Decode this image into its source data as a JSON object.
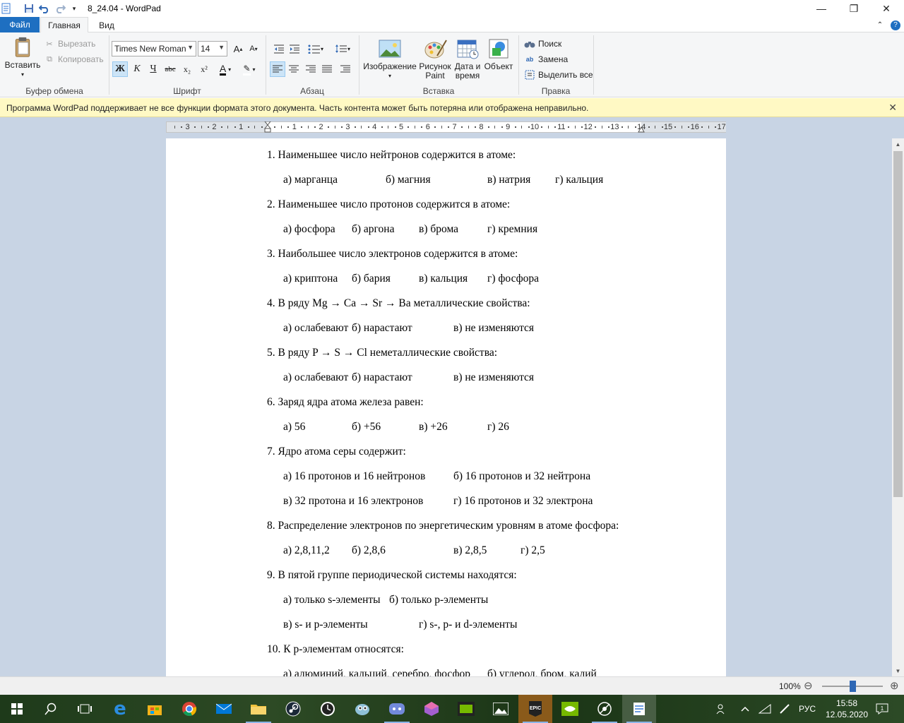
{
  "window": {
    "title": "8_24.04 - WordPad",
    "controls": {
      "minimize": "—",
      "restore": "❐",
      "close": "✕"
    }
  },
  "tabs": {
    "file": "Файл",
    "home": "Главная",
    "view": "Вид"
  },
  "ribbon": {
    "clipboard": {
      "paste": "Вставить",
      "cut": "Вырезать",
      "copy": "Копировать",
      "group": "Буфер обмена"
    },
    "font": {
      "family": "Times New Roman",
      "size": "14",
      "bold": "Ж",
      "italic": "К",
      "underline": "Ч",
      "strike": "abc",
      "sub": "x₂",
      "sup": "x²",
      "group": "Шрифт"
    },
    "paragraph": {
      "group": "Абзац"
    },
    "insert": {
      "image": "Изображение",
      "paint_line1": "Рисунок",
      "paint_line2": "Paint",
      "datetime_line1": "Дата и",
      "datetime_line2": "время",
      "object": "Объект",
      "group": "Вставка"
    },
    "edit": {
      "find": "Поиск",
      "replace": "Замена",
      "select_all": "Выделить все",
      "group": "Правка"
    }
  },
  "notification": {
    "message": "Программа WordPad поддерживает не все функции формата этого документа. Часть контента может быть потеряна или отображена неправильно.",
    "close": "✕"
  },
  "ruler": {
    "left_numbers": [
      "3",
      "2",
      "1"
    ],
    "right_numbers": [
      "1",
      "2",
      "3",
      "4",
      "5",
      "6",
      "7",
      "8",
      "9",
      "10",
      "11",
      "12",
      "13",
      "14",
      "15",
      "16",
      "17"
    ]
  },
  "document": {
    "lines": [
      {
        "segments": [
          "1. Наименьшее  число нейтронов содержится в атоме:"
        ]
      },
      {
        "segments": [
          "а) марганца",
          "б) магния",
          "в) натрия",
          "г) кальция"
        ]
      },
      {
        "segments": [
          "2. Наименьшее число протонов содержится в атоме:"
        ]
      },
      {
        "segments": [
          "а) фосфора",
          "б) аргона",
          "в) брома",
          "г) кремния"
        ]
      },
      {
        "segments": [
          "3. Наибольшее  число электронов содержится в атоме:"
        ]
      },
      {
        "segments": [
          "а) криптона",
          "б) бария",
          "в) кальция",
          "г) фосфора"
        ]
      },
      {
        "segments": [
          "4. В ряду Mg → Ca → Sr → Ba металлические свойства:"
        ]
      },
      {
        "segments": [
          "а) ослабевают",
          "б) нарастают",
          "в) не изменяются"
        ]
      },
      {
        "segments": [
          "5. В ряду P → S → Cl неметаллические свойства:"
        ]
      },
      {
        "segments": [
          "а) ослабевают",
          "б) нарастают",
          "в) не изменяются"
        ]
      },
      {
        "segments": [
          "6. Заряд ядра атома железа равен:"
        ]
      },
      {
        "segments": [
          "а) 56",
          "б)  +56",
          "в) +26",
          "г) 26"
        ]
      },
      {
        "segments": [
          "7. Ядро атома серы содержит:"
        ]
      },
      {
        "segments": [
          "а) 16 протонов и 16 нейтронов",
          "б) 16 протонов и 32 нейтрона"
        ]
      },
      {
        "segments": [
          "в) 32 протона и 16 электронов",
          "г)  16 протонов и 32 электрона"
        ]
      },
      {
        "segments": [
          "8. Распределение электронов по энергетическим уровням в атоме фосфора:"
        ]
      },
      {
        "segments": [
          "а) 2,8,11,2",
          "б) 2,8,6",
          "в) 2,8,5",
          "г) 2,5"
        ]
      },
      {
        "segments": [
          "9. В пятой группе периодической системы находятся:"
        ]
      },
      {
        "segments": [
          "а) только  s-элементы",
          "б) только  p-элементы"
        ]
      },
      {
        "segments": [
          "в) s- и p-элементы",
          "г) s-, p- и d-элементы"
        ]
      },
      {
        "segments": [
          "10. К p-элементам относятся:"
        ]
      },
      {
        "segments": [
          "а) алюминий, кальций, серебро, фосфор",
          "б) углерод, бром, калий"
        ]
      }
    ]
  },
  "statusbar": {
    "zoom": "100%",
    "zoom_out": "⊖",
    "zoom_in": "⊕",
    "zoom_level": 0.5
  },
  "taskbar": {
    "language": "РУС",
    "time": "15:58",
    "date": "12.05.2020"
  },
  "colors": {
    "file_tab": "#1e6fc1",
    "notification": "#fff9c4",
    "doc_background": "#c8d4e4",
    "accent": "#1e6fc1"
  }
}
